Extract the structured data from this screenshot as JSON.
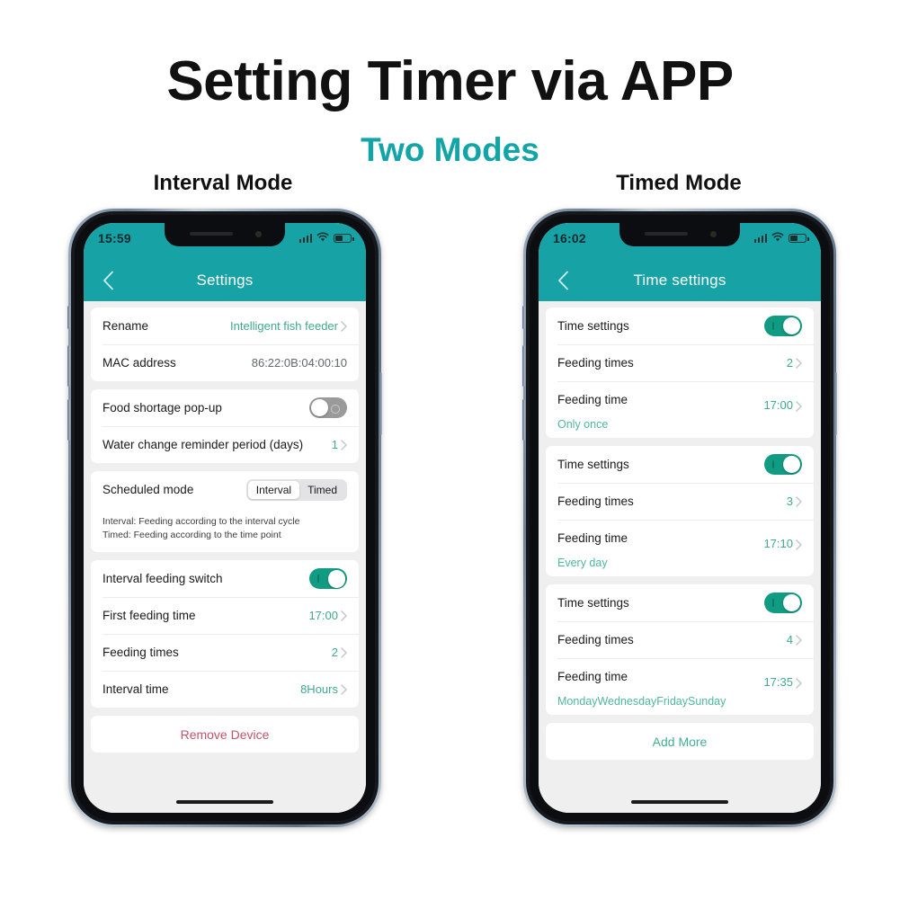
{
  "heading": {
    "title": "Setting Timer via APP",
    "subtitle": "Two Modes",
    "subtitle_color": "#12a5a8",
    "left_mode_label": "Interval Mode",
    "right_mode_label": "Timed Mode"
  },
  "theme": {
    "header_teal": "#17a2a6",
    "toggle_on": "#119b82",
    "toggle_off": "#9a9a9a",
    "value_teal": "#3fa98e",
    "danger_red": "#c2546a",
    "screen_bg": "#efefef"
  },
  "left_phone": {
    "status": {
      "time": "15:59",
      "signal_icon": "signal-bars-icon",
      "wifi_icon": "wifi-icon",
      "battery_icon": "battery-icon"
    },
    "nav": {
      "back_icon": "chevron-left-icon",
      "title": "Settings"
    },
    "cards": [
      {
        "rows": [
          {
            "type": "value",
            "label": "Rename",
            "value": "Intelligent fish feeder",
            "value_style": "teal",
            "chevron": true
          },
          {
            "type": "value",
            "label": "MAC address",
            "value": "86:22:0B:04:00:10",
            "value_style": "gray",
            "chevron": false
          }
        ]
      },
      {
        "rows": [
          {
            "type": "toggle",
            "label": "Food shortage pop-up",
            "state": "off"
          },
          {
            "type": "value",
            "label": "Water change reminder period (days)",
            "value": "1",
            "value_style": "teal",
            "chevron": true
          }
        ]
      },
      {
        "rows": [
          {
            "type": "segmented",
            "label": "Scheduled mode",
            "options": [
              "Interval",
              "Timed"
            ],
            "selected": "Interval"
          },
          {
            "type": "note",
            "lines": [
              "Interval: Feeding according to the interval cycle",
              "Timed: Feeding according to the time point"
            ]
          }
        ]
      },
      {
        "rows": [
          {
            "type": "toggle",
            "label": "Interval feeding switch",
            "state": "on"
          },
          {
            "type": "value",
            "label": "First feeding time",
            "value": "17:00",
            "value_style": "teal",
            "chevron": true
          },
          {
            "type": "value",
            "label": "Feeding times",
            "value": "2",
            "value_style": "teal",
            "chevron": true
          },
          {
            "type": "value",
            "label": "Interval time",
            "value": "8Hours",
            "value_style": "teal",
            "chevron": true
          }
        ]
      },
      {
        "rows": [
          {
            "type": "action",
            "label": "Remove Device",
            "style": "danger"
          }
        ]
      }
    ]
  },
  "right_phone": {
    "status": {
      "time": "16:02",
      "signal_icon": "signal-bars-icon",
      "wifi_icon": "wifi-icon",
      "battery_icon": "battery-icon"
    },
    "nav": {
      "back_icon": "chevron-left-icon",
      "title": "Time settings"
    },
    "cards": [
      {
        "rows": [
          {
            "type": "toggle",
            "label": "Time settings",
            "state": "on"
          },
          {
            "type": "value",
            "label": "Feeding times",
            "value": "2",
            "value_style": "teal",
            "chevron": true
          },
          {
            "type": "twoline",
            "label": "Feeding time",
            "sub": "Only once",
            "value": "17:00",
            "value_style": "teal",
            "chevron": true
          }
        ]
      },
      {
        "rows": [
          {
            "type": "toggle",
            "label": "Time settings",
            "state": "on"
          },
          {
            "type": "value",
            "label": "Feeding times",
            "value": "3",
            "value_style": "teal",
            "chevron": true
          },
          {
            "type": "twoline",
            "label": "Feeding time",
            "sub": "Every day",
            "value": "17:10",
            "value_style": "teal",
            "chevron": true
          }
        ]
      },
      {
        "rows": [
          {
            "type": "toggle",
            "label": "Time settings",
            "state": "on"
          },
          {
            "type": "value",
            "label": "Feeding times",
            "value": "4",
            "value_style": "teal",
            "chevron": true
          },
          {
            "type": "twoline",
            "label": "Feeding time",
            "sub": "MondayWednesdayFridaySunday",
            "value": "17:35",
            "value_style": "teal",
            "chevron": true
          }
        ]
      },
      {
        "rows": [
          {
            "type": "action",
            "label": "Add More",
            "style": "teal"
          }
        ]
      }
    ]
  }
}
